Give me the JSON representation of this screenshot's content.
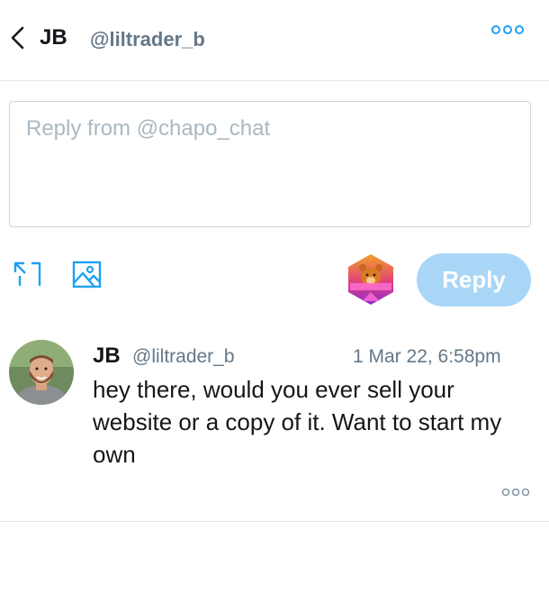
{
  "header": {
    "name": "JB",
    "handle": "@liltrader_b"
  },
  "composer": {
    "placeholder": "Reply from @chapo_chat",
    "value": "",
    "reply_label": "Reply"
  },
  "icons": {
    "back": "chevron-left-icon",
    "more": "more-dots-icon",
    "expand": "expand-icon",
    "image": "image-icon",
    "account_logo": "bear-logo-icon"
  },
  "message": {
    "name": "JB",
    "handle": "@liltrader_b",
    "timestamp": "1 Mar 22, 6:58pm",
    "text": "hey there, would you ever sell your website or a copy of it. Want to start my own"
  },
  "colors": {
    "accent": "#1da1f2",
    "reply_button_disabled": "#a9d6f7",
    "text_primary": "#14171a",
    "text_secondary": "#657786",
    "border": "#e1e8ed"
  }
}
